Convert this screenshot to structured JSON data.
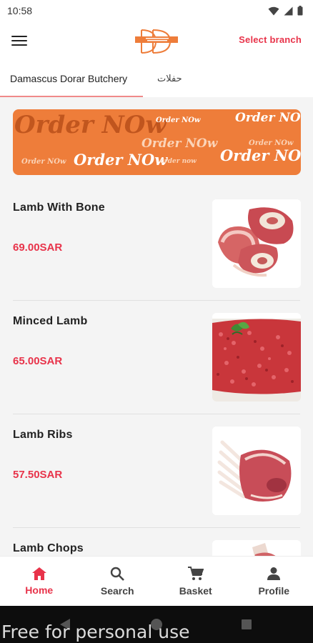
{
  "status_bar": {
    "time": "10:58"
  },
  "header": {
    "select_branch_label": "Select branch"
  },
  "tabs": [
    {
      "label": "Damascus Dorar Butchery",
      "active": true
    },
    {
      "label": "حفلات",
      "active": false
    }
  ],
  "banner": {
    "text": "Order NOw",
    "small_text": "order now"
  },
  "products": [
    {
      "name": "Lamb With Bone",
      "price": "69.00SAR",
      "image": "lamb-with-bone-image"
    },
    {
      "name": "Minced Lamb",
      "price": "65.00SAR",
      "image": "minced-lamb-image"
    },
    {
      "name": "Lamb Ribs",
      "price": "57.50SAR",
      "image": "lamb-ribs-image"
    },
    {
      "name": "Lamb Chops",
      "price": "",
      "image": "lamb-chops-image"
    }
  ],
  "bottom_nav": [
    {
      "label": "Home",
      "icon": "home-icon",
      "active": true
    },
    {
      "label": "Search",
      "icon": "search-icon",
      "active": false
    },
    {
      "label": "Basket",
      "icon": "basket-icon",
      "active": false
    },
    {
      "label": "Profile",
      "icon": "profile-icon",
      "active": false
    }
  ],
  "watermark": "Free for personal use",
  "colors": {
    "accent": "#e8334a",
    "banner": "#ee7d3a",
    "background": "#f4f4f4"
  }
}
